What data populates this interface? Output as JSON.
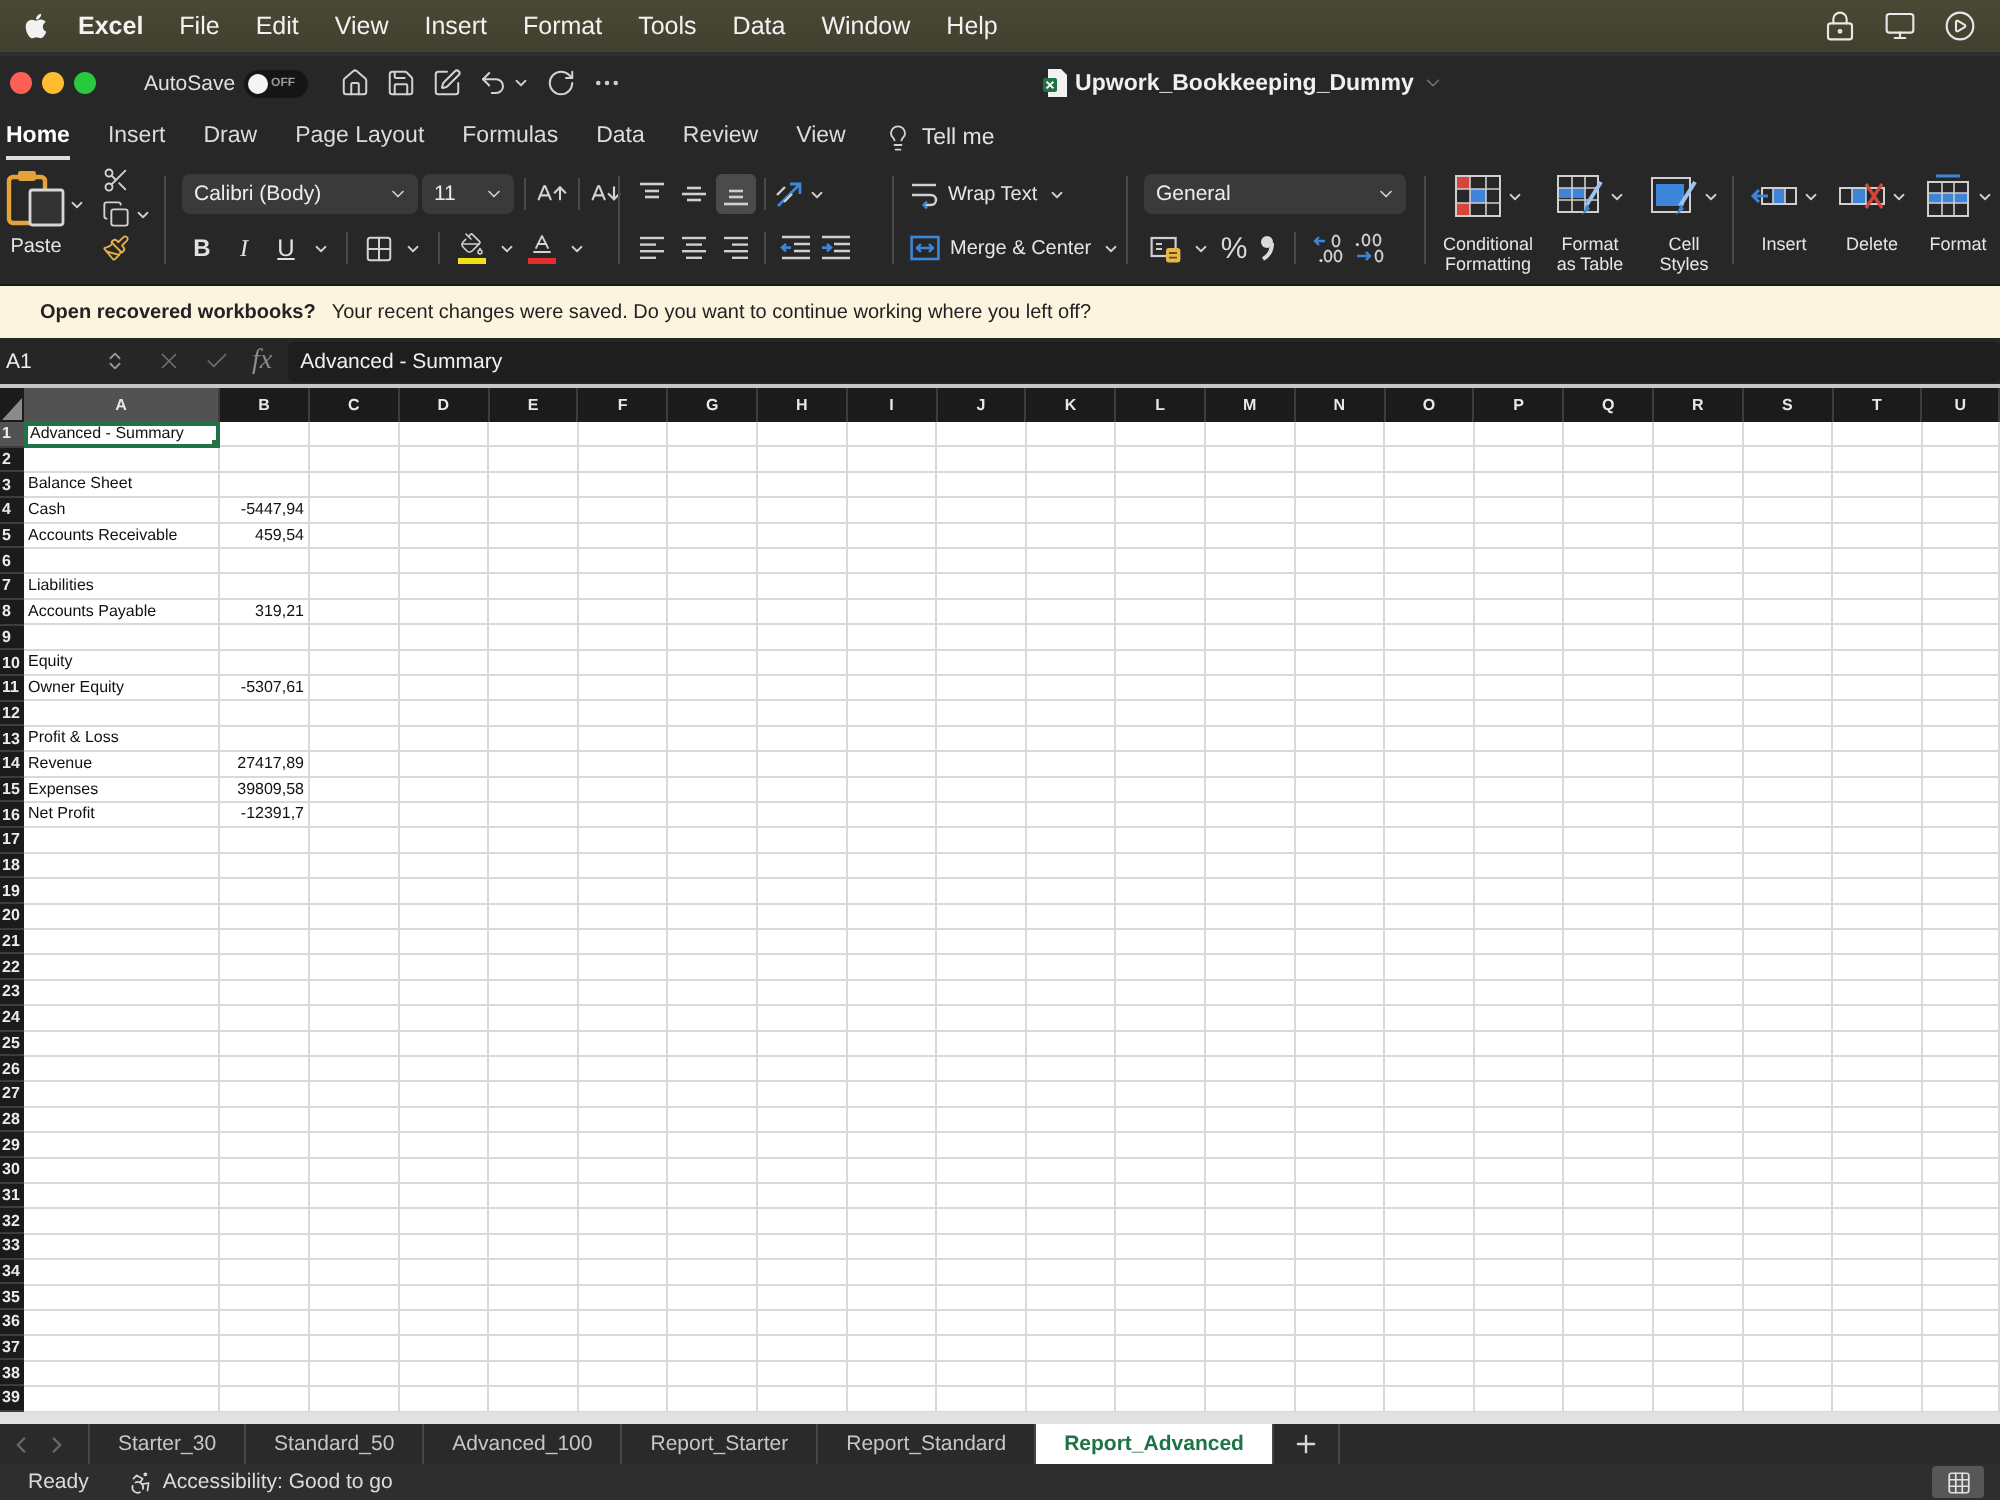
{
  "menu_bar": {
    "app_name": "Excel",
    "items": [
      "File",
      "Edit",
      "View",
      "Insert",
      "Format",
      "Tools",
      "Data",
      "Window",
      "Help"
    ]
  },
  "title_bar": {
    "autosave": {
      "label": "AutoSave",
      "on": false,
      "state_text": "OFF"
    },
    "document_title": "Upwork_Bookkeeping_Dummy"
  },
  "ribbon_tabs": [
    {
      "label": "Home",
      "selected": true
    },
    {
      "label": "Insert",
      "selected": false
    },
    {
      "label": "Draw",
      "selected": false
    },
    {
      "label": "Page Layout",
      "selected": false
    },
    {
      "label": "Formulas",
      "selected": false
    },
    {
      "label": "Data",
      "selected": false
    },
    {
      "label": "Review",
      "selected": false
    },
    {
      "label": "View",
      "selected": false
    }
  ],
  "tell_me": "Tell me",
  "ribbon": {
    "paste_label": "Paste",
    "font_name": "Calibri (Body)",
    "font_size": "11",
    "text_styles": [
      {
        "kind": "bold",
        "label": "B"
      },
      {
        "kind": "italic",
        "label": "I"
      },
      {
        "kind": "underline",
        "label": "U"
      }
    ],
    "vertical_align": [
      {
        "kind": "top",
        "selected": false
      },
      {
        "kind": "middle",
        "selected": false
      },
      {
        "kind": "bottom",
        "selected": true
      }
    ],
    "wrap_text": "Wrap Text",
    "merge": "Merge & Center",
    "number_format": "General",
    "percent": "%",
    "style_buttons": [
      {
        "kind": "conditional_formatting",
        "label": "Conditional Formatting"
      },
      {
        "kind": "format_as_table",
        "label": "Format as Table"
      },
      {
        "kind": "cell_styles",
        "label": "Cell Styles"
      }
    ],
    "cell_buttons": [
      {
        "kind": "insert",
        "label": "Insert"
      },
      {
        "kind": "delete",
        "label": "Delete"
      },
      {
        "kind": "format",
        "label": "Format"
      }
    ]
  },
  "notification": {
    "title": "Open recovered workbooks?",
    "message": "Your recent changes were saved. Do you want to continue working where you left off?"
  },
  "formula_bar": {
    "name_box": "A1",
    "function_label": "fx",
    "formula": "Advanced - Summary"
  },
  "sheet": {
    "columns": [
      {
        "label": "A",
        "selected": true
      },
      {
        "label": "B",
        "selected": false
      },
      {
        "label": "C",
        "selected": false
      },
      {
        "label": "D",
        "selected": false
      },
      {
        "label": "E",
        "selected": false
      },
      {
        "label": "F",
        "selected": false
      },
      {
        "label": "G",
        "selected": false
      },
      {
        "label": "H",
        "selected": false
      },
      {
        "label": "I",
        "selected": false
      },
      {
        "label": "J",
        "selected": false
      },
      {
        "label": "K",
        "selected": false
      },
      {
        "label": "L",
        "selected": false
      },
      {
        "label": "M",
        "selected": false
      },
      {
        "label": "N",
        "selected": false
      },
      {
        "label": "O",
        "selected": false
      },
      {
        "label": "P",
        "selected": false
      },
      {
        "label": "Q",
        "selected": false
      },
      {
        "label": "R",
        "selected": false
      },
      {
        "label": "S",
        "selected": false
      },
      {
        "label": "T",
        "selected": false
      },
      {
        "label": "U",
        "selected": false
      }
    ],
    "rows": [
      {
        "number": "1",
        "selected": true,
        "cells": [
          "Advanced - Summary"
        ]
      },
      {
        "number": "2",
        "selected": false
      },
      {
        "number": "3",
        "selected": false,
        "cells": [
          "Balance Sheet"
        ]
      },
      {
        "number": "4",
        "selected": false,
        "cells": [
          "Cash",
          "-5447,94"
        ]
      },
      {
        "number": "5",
        "selected": false,
        "cells": [
          "Accounts Receivable",
          "459,54"
        ]
      },
      {
        "number": "6",
        "selected": false
      },
      {
        "number": "7",
        "selected": false,
        "cells": [
          "Liabilities"
        ]
      },
      {
        "number": "8",
        "selected": false,
        "cells": [
          "Accounts Payable",
          "319,21"
        ]
      },
      {
        "number": "9",
        "selected": false
      },
      {
        "number": "10",
        "selected": false,
        "cells": [
          "Equity"
        ]
      },
      {
        "number": "11",
        "selected": false,
        "cells": [
          "Owner Equity",
          "-5307,61"
        ]
      },
      {
        "number": "12",
        "selected": false
      },
      {
        "number": "13",
        "selected": false,
        "cells": [
          "Profit & Loss"
        ]
      },
      {
        "number": "14",
        "selected": false,
        "cells": [
          "Revenue",
          "27417,89"
        ]
      },
      {
        "number": "15",
        "selected": false,
        "cells": [
          "Expenses",
          "39809,58"
        ]
      },
      {
        "number": "16",
        "selected": false,
        "cells": [
          "Net Profit",
          "-12391,7"
        ]
      },
      {
        "number": "17",
        "selected": false
      },
      {
        "number": "18",
        "selected": false
      },
      {
        "number": "19",
        "selected": false
      },
      {
        "number": "20",
        "selected": false
      },
      {
        "number": "21",
        "selected": false
      },
      {
        "number": "22",
        "selected": false
      },
      {
        "number": "23",
        "selected": false
      },
      {
        "number": "24",
        "selected": false
      },
      {
        "number": "25",
        "selected": false
      },
      {
        "number": "26",
        "selected": false
      },
      {
        "number": "27",
        "selected": false
      },
      {
        "number": "28",
        "selected": false
      },
      {
        "number": "29",
        "selected": false
      },
      {
        "number": "30",
        "selected": false
      },
      {
        "number": "31",
        "selected": false
      },
      {
        "number": "32",
        "selected": false
      },
      {
        "number": "33",
        "selected": false
      },
      {
        "number": "34",
        "selected": false
      },
      {
        "number": "35",
        "selected": false
      },
      {
        "number": "36",
        "selected": false
      },
      {
        "number": "37",
        "selected": false
      },
      {
        "number": "38",
        "selected": false
      },
      {
        "number": "39",
        "selected": false
      }
    ]
  },
  "sheet_tabs": [
    {
      "label": "Starter_30",
      "selected": false
    },
    {
      "label": "Standard_50",
      "selected": false
    },
    {
      "label": "Advanced_100",
      "selected": false
    },
    {
      "label": "Report_Starter",
      "selected": false
    },
    {
      "label": "Report_Standard",
      "selected": false
    },
    {
      "label": "Report_Advanced",
      "selected": true
    }
  ],
  "status_bar": {
    "status": "Ready",
    "accessibility": "Accessibility: Good to go",
    "views": [
      {
        "kind": "normal",
        "selected": true
      }
    ]
  }
}
